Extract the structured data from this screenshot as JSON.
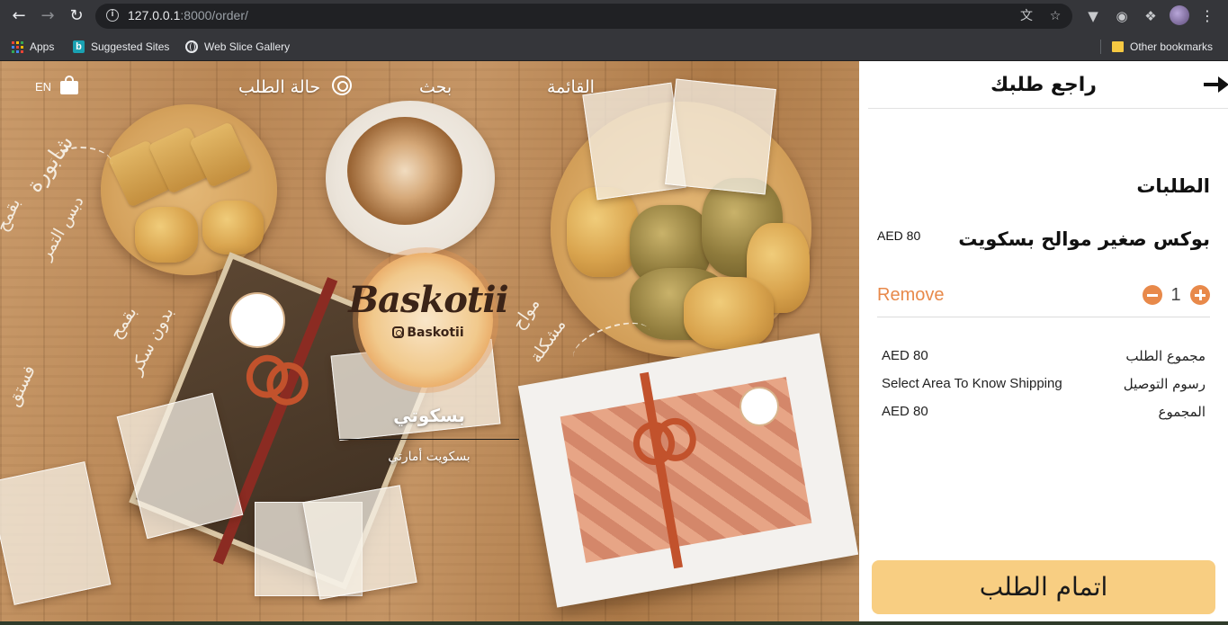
{
  "browser": {
    "url_host": "127.0.0.1",
    "url_rest": ":8000/order/",
    "bookmarks": [
      {
        "label": "Apps",
        "icon": "apps-grid-icon"
      },
      {
        "label": "Suggested Sites",
        "icon": "bing-icon"
      },
      {
        "label": "Web Slice Gallery",
        "icon": "globe-icon"
      }
    ],
    "other_bookmarks": "Other bookmarks"
  },
  "site_nav": {
    "lang": "EN",
    "order_status": "حالة الطلب",
    "search": "بحث",
    "menu": "القائمة"
  },
  "brand": {
    "logo_text": "Baskotii",
    "handle": "Baskotii",
    "title": "بسكوتي",
    "subtitle": "بسكويت أمارتي"
  },
  "hero_scribbles": [
    "شابورة",
    "بقمح",
    "دبس التمر",
    "بقمح",
    "بدون سكر",
    "فستق",
    "مواح",
    "مشكلة"
  ],
  "panel": {
    "title": "راجع طلبك",
    "orders_heading": "الطلبات",
    "item": {
      "name": "بوكس صغير موالح بسكويت",
      "price": "AED 80",
      "quantity": "1",
      "remove_label": "Remove"
    },
    "summary": [
      {
        "label": "مجموع الطلب",
        "value": "AED 80"
      },
      {
        "label": "رسوم التوصيل",
        "value": "Select Area To Know Shipping"
      },
      {
        "label": "المجموع",
        "value": "AED 80"
      }
    ],
    "checkout_label": "اتمام الطلب"
  },
  "colors": {
    "accent": "#e8894a",
    "checkout_bg": "#f8ce82",
    "chrome_bg": "#35363a"
  }
}
